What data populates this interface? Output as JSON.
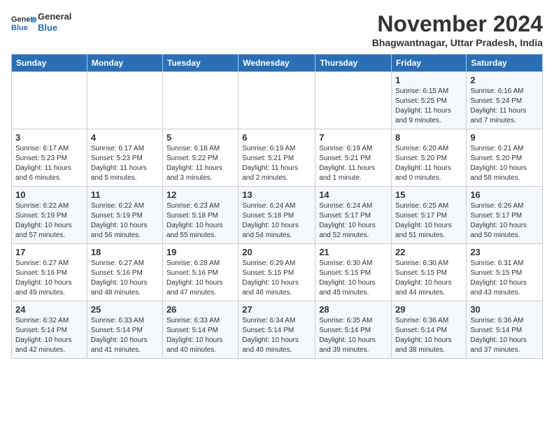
{
  "logo": {
    "line1": "General",
    "line2": "Blue"
  },
  "title": "November 2024",
  "location": "Bhagwantnagar, Uttar Pradesh, India",
  "weekdays": [
    "Sunday",
    "Monday",
    "Tuesday",
    "Wednesday",
    "Thursday",
    "Friday",
    "Saturday"
  ],
  "rows": [
    [
      {
        "day": "",
        "info": ""
      },
      {
        "day": "",
        "info": ""
      },
      {
        "day": "",
        "info": ""
      },
      {
        "day": "",
        "info": ""
      },
      {
        "day": "",
        "info": ""
      },
      {
        "day": "1",
        "info": "Sunrise: 6:15 AM\nSunset: 5:25 PM\nDaylight: 11 hours\nand 9 minutes."
      },
      {
        "day": "2",
        "info": "Sunrise: 6:16 AM\nSunset: 5:24 PM\nDaylight: 11 hours\nand 7 minutes."
      }
    ],
    [
      {
        "day": "3",
        "info": "Sunrise: 6:17 AM\nSunset: 5:23 PM\nDaylight: 11 hours\nand 6 minutes."
      },
      {
        "day": "4",
        "info": "Sunrise: 6:17 AM\nSunset: 5:23 PM\nDaylight: 11 hours\nand 5 minutes."
      },
      {
        "day": "5",
        "info": "Sunrise: 6:18 AM\nSunset: 5:22 PM\nDaylight: 11 hours\nand 3 minutes."
      },
      {
        "day": "6",
        "info": "Sunrise: 6:19 AM\nSunset: 5:21 PM\nDaylight: 11 hours\nand 2 minutes."
      },
      {
        "day": "7",
        "info": "Sunrise: 6:19 AM\nSunset: 5:21 PM\nDaylight: 11 hours\nand 1 minute."
      },
      {
        "day": "8",
        "info": "Sunrise: 6:20 AM\nSunset: 5:20 PM\nDaylight: 11 hours\nand 0 minutes."
      },
      {
        "day": "9",
        "info": "Sunrise: 6:21 AM\nSunset: 5:20 PM\nDaylight: 10 hours\nand 58 minutes."
      }
    ],
    [
      {
        "day": "10",
        "info": "Sunrise: 6:22 AM\nSunset: 5:19 PM\nDaylight: 10 hours\nand 57 minutes."
      },
      {
        "day": "11",
        "info": "Sunrise: 6:22 AM\nSunset: 5:19 PM\nDaylight: 10 hours\nand 56 minutes."
      },
      {
        "day": "12",
        "info": "Sunrise: 6:23 AM\nSunset: 5:18 PM\nDaylight: 10 hours\nand 55 minutes."
      },
      {
        "day": "13",
        "info": "Sunrise: 6:24 AM\nSunset: 5:18 PM\nDaylight: 10 hours\nand 54 minutes."
      },
      {
        "day": "14",
        "info": "Sunrise: 6:24 AM\nSunset: 5:17 PM\nDaylight: 10 hours\nand 52 minutes."
      },
      {
        "day": "15",
        "info": "Sunrise: 6:25 AM\nSunset: 5:17 PM\nDaylight: 10 hours\nand 51 minutes."
      },
      {
        "day": "16",
        "info": "Sunrise: 6:26 AM\nSunset: 5:17 PM\nDaylight: 10 hours\nand 50 minutes."
      }
    ],
    [
      {
        "day": "17",
        "info": "Sunrise: 6:27 AM\nSunset: 5:16 PM\nDaylight: 10 hours\nand 49 minutes."
      },
      {
        "day": "18",
        "info": "Sunrise: 6:27 AM\nSunset: 5:16 PM\nDaylight: 10 hours\nand 48 minutes."
      },
      {
        "day": "19",
        "info": "Sunrise: 6:28 AM\nSunset: 5:16 PM\nDaylight: 10 hours\nand 47 minutes."
      },
      {
        "day": "20",
        "info": "Sunrise: 6:29 AM\nSunset: 5:15 PM\nDaylight: 10 hours\nand 46 minutes."
      },
      {
        "day": "21",
        "info": "Sunrise: 6:30 AM\nSunset: 5:15 PM\nDaylight: 10 hours\nand 45 minutes."
      },
      {
        "day": "22",
        "info": "Sunrise: 6:30 AM\nSunset: 5:15 PM\nDaylight: 10 hours\nand 44 minutes."
      },
      {
        "day": "23",
        "info": "Sunrise: 6:31 AM\nSunset: 5:15 PM\nDaylight: 10 hours\nand 43 minutes."
      }
    ],
    [
      {
        "day": "24",
        "info": "Sunrise: 6:32 AM\nSunset: 5:14 PM\nDaylight: 10 hours\nand 42 minutes."
      },
      {
        "day": "25",
        "info": "Sunrise: 6:33 AM\nSunset: 5:14 PM\nDaylight: 10 hours\nand 41 minutes."
      },
      {
        "day": "26",
        "info": "Sunrise: 6:33 AM\nSunset: 5:14 PM\nDaylight: 10 hours\nand 40 minutes."
      },
      {
        "day": "27",
        "info": "Sunrise: 6:34 AM\nSunset: 5:14 PM\nDaylight: 10 hours\nand 40 minutes."
      },
      {
        "day": "28",
        "info": "Sunrise: 6:35 AM\nSunset: 5:14 PM\nDaylight: 10 hours\nand 39 minutes."
      },
      {
        "day": "29",
        "info": "Sunrise: 6:36 AM\nSunset: 5:14 PM\nDaylight: 10 hours\nand 38 minutes."
      },
      {
        "day": "30",
        "info": "Sunrise: 6:36 AM\nSunset: 5:14 PM\nDaylight: 10 hours\nand 37 minutes."
      }
    ]
  ]
}
